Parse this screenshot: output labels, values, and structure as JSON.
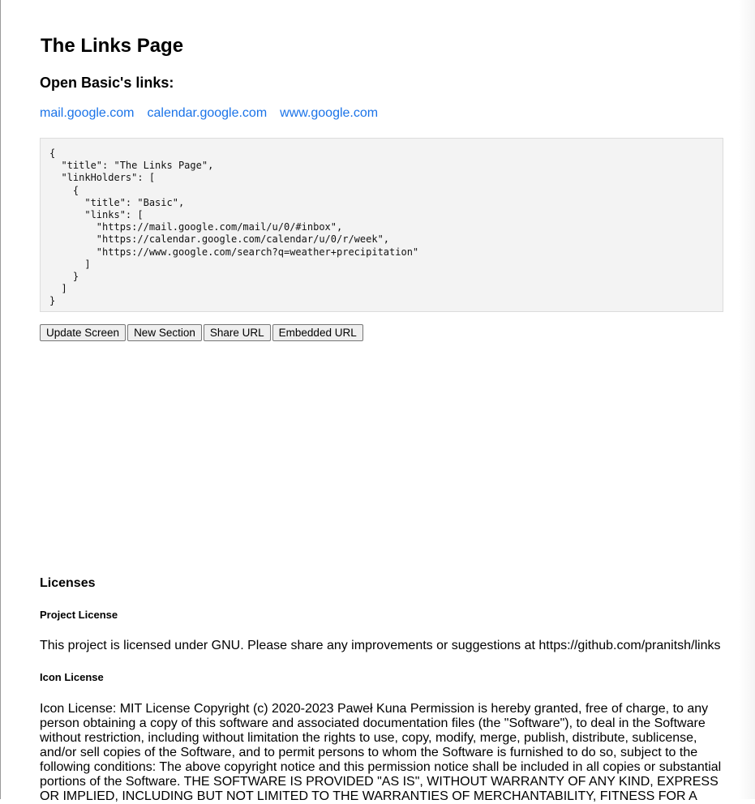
{
  "page": {
    "title": "The Links Page"
  },
  "section": {
    "title": "Open Basic's links:",
    "links": [
      "mail.google.com",
      "calendar.google.com",
      "www.google.com"
    ]
  },
  "config_json": "{\n  \"title\": \"The Links Page\",\n  \"linkHolders\": [\n    {\n      \"title\": \"Basic\",\n      \"links\": [\n        \"https://mail.google.com/mail/u/0/#inbox\",\n        \"https://calendar.google.com/calendar/u/0/r/week\",\n        \"https://www.google.com/search?q=weather+precipitation\"\n      ]\n    }\n  ]\n}",
  "buttons": {
    "update_screen": "Update Screen",
    "new_section": "New Section",
    "share_url": "Share URL",
    "embedded_url": "Embedded URL"
  },
  "licenses": {
    "title": "Licenses",
    "project_license_title": "Project License",
    "project_license_text": "This project is licensed under GNU. Please share any improvements or suggestions at https://github.com/pranitsh/links",
    "icon_license_title": "Icon License",
    "icon_license_text": "Icon License: MIT License Copyright (c) 2020-2023 Paweł Kuna Permission is hereby granted, free of charge, to any person obtaining a copy of this software and associated documentation files (the \"Software\"), to deal in the Software without restriction, including without limitation the rights to use, copy, modify, merge, publish, distribute, sublicense, and/or sell copies of the Software, and to permit persons to whom the Software is furnished to do so, subject to the following conditions: The above copyright notice and this permission notice shall be included in all copies or substantial portions of the Software. THE SOFTWARE IS PROVIDED \"AS IS\", WITHOUT WARRANTY OF ANY KIND, EXPRESS OR IMPLIED, INCLUDING BUT NOT LIMITED TO THE WARRANTIES OF MERCHANTABILITY, FITNESS FOR A"
  }
}
